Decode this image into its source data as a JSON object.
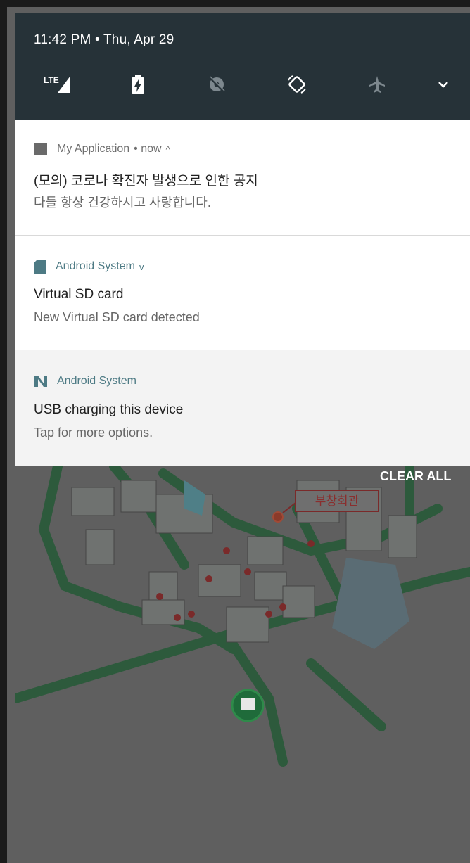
{
  "status_bar": {
    "time": "11:42 PM",
    "date": "Thu, Apr 29",
    "separator": "•",
    "lte_label": "LTE",
    "tiles": [
      {
        "icon": "lte-signal-icon"
      },
      {
        "icon": "battery-charging-icon"
      },
      {
        "icon": "location-off-icon"
      },
      {
        "icon": "auto-rotate-icon"
      },
      {
        "icon": "airplane-mode-icon"
      },
      {
        "icon": "chevron-down-icon"
      }
    ]
  },
  "notifications": [
    {
      "app": "My Application",
      "meta": "• now",
      "expand_glyph": "^",
      "title": "(모의) 코로나 확진자 발생으로 인한 공지",
      "text": "다들 항상 건강하시고 사랑합니다."
    },
    {
      "app": "Android System",
      "expand_glyph": "v",
      "title": "Virtual SD card",
      "text": "New Virtual SD card detected"
    },
    {
      "app": "Android System",
      "title": "USB charging this device",
      "text": "Tap for more options."
    }
  ],
  "actions": {
    "clear_all": "CLEAR ALL"
  },
  "background": {
    "map_label": "부창회관"
  },
  "colors": {
    "quick_settings_bg": "#263238",
    "app_accent": "#4d7a84",
    "scrim": "#5f5f5f",
    "map_road": "#2e5d40"
  }
}
